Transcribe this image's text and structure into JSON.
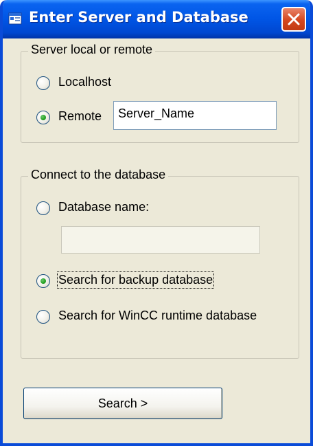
{
  "window": {
    "title": "Enter Server and Database",
    "icon": "app-window-icon",
    "close_icon": "close-icon"
  },
  "server_group": {
    "legend": "Server local or remote",
    "localhost_label": "Localhost",
    "remote_label": "Remote",
    "selected": "Remote",
    "server_value": "Server_Name"
  },
  "database_group": {
    "legend": "Connect to the database",
    "db_name_label": "Database name:",
    "db_name_value": "",
    "backup_label": "Search for backup database",
    "wincc_label": "Search for WinCC runtime database",
    "selected": "Search for backup database"
  },
  "actions": {
    "search_label": "Search >"
  },
  "colors": {
    "titlebar": "#0055E5",
    "window_face": "#ECE9D8",
    "close_button": "#D4471F",
    "radio_dot": "#21A121"
  }
}
